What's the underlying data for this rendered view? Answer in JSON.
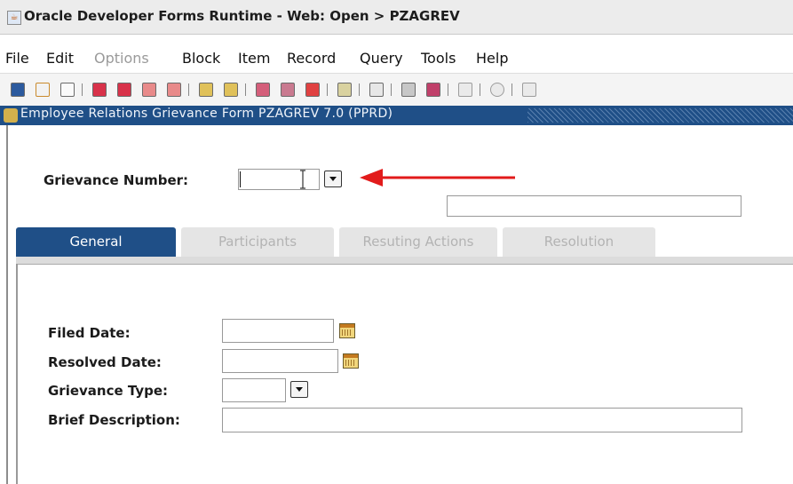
{
  "window": {
    "title": "Oracle Developer Forms Runtime - Web:  Open > PZAGREV"
  },
  "menu": [
    {
      "label": "File",
      "enabled": true
    },
    {
      "label": "Edit",
      "enabled": true
    },
    {
      "label": "Options",
      "enabled": false
    },
    {
      "label": "Block",
      "enabled": true
    },
    {
      "label": "Item",
      "enabled": true
    },
    {
      "label": "Record",
      "enabled": true
    },
    {
      "label": "Query",
      "enabled": true
    },
    {
      "label": "Tools",
      "enabled": true
    },
    {
      "label": "Help",
      "enabled": true
    }
  ],
  "toolbar": {
    "icons": [
      "save-icon",
      "undo-icon",
      "print-icon",
      "enter-query-icon",
      "execute-query-icon",
      "previous-block-icon",
      "next-block-icon",
      "previous-record-icon",
      "next-record-icon",
      "insert-record-icon",
      "remove-record-icon",
      "clear-record-icon",
      "list-of-values-icon",
      "edit-icon",
      "export-icon",
      "clear-form-icon",
      "help-icon",
      "target-icon",
      "exit-icon"
    ]
  },
  "form": {
    "title": "Employee Relations Grievance Form  PZAGREV  7.0  (PPRD)",
    "key_block": {
      "grievance_number_label": "Grievance Number:",
      "grievance_number_value": "",
      "description_value": ""
    },
    "tabs": [
      {
        "label": "General",
        "active": true
      },
      {
        "label": "Participants",
        "active": false
      },
      {
        "label": "Resuting Actions",
        "active": false
      },
      {
        "label": "Resolution",
        "active": false
      }
    ],
    "general": {
      "filed_date_label": "Filed Date:",
      "filed_date_value": "",
      "resolved_date_label": "Resolved Date:",
      "resolved_date_value": "",
      "grievance_type_label": "Grievance Type:",
      "grievance_type_value": "",
      "brief_description_label": "Brief Description:",
      "brief_description_value": ""
    }
  },
  "colors": {
    "form_bar": "#1f4f87",
    "annotation_arrow": "#e21b1b",
    "tab_inactive_text": "#b3b3b3"
  }
}
